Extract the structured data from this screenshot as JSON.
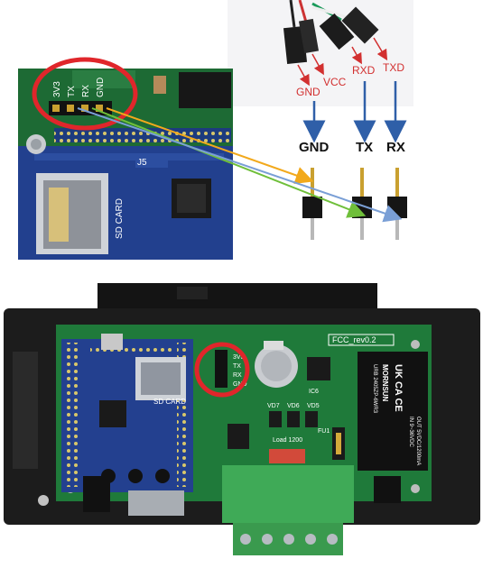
{
  "header_pin_labels": [
    "3V3",
    "TX",
    "RX",
    "GND"
  ],
  "usb_adapter_wires": [
    "GND",
    "VCC",
    "RXD",
    "TXD"
  ],
  "target_header": [
    "GND",
    "TX",
    "RX"
  ],
  "board_silkscreen": {
    "pin_labels": [
      "3V3",
      "TX",
      "RX",
      "GND"
    ],
    "revision": "FCC_rev0.2",
    "card_label": "SD CARD",
    "jumper_label": "J5",
    "diode_labels": [
      "VD7",
      "VD6",
      "VD5"
    ],
    "load_label": "Load 1200",
    "fuse_label": "FU1",
    "ic_label": "IC6"
  },
  "power_module": {
    "brand": "MORNSUN",
    "model": "URB 2405ZP-6WR3",
    "input": "IN 9~36VDC",
    "output": "OUT 5VDC/1200mA",
    "marks": "UK CA CE"
  },
  "colors": {
    "highlight": "#e0262b",
    "arrow_blue": "#2f5fa8",
    "wire_gnd": "#f2a91c",
    "wire_tx": "#6fbf3a",
    "wire_rx": "#7a9fd6",
    "pcb_green": "#1f7a3a",
    "pcb_blue": "#23408f",
    "terminal_green": "#3faa57"
  }
}
